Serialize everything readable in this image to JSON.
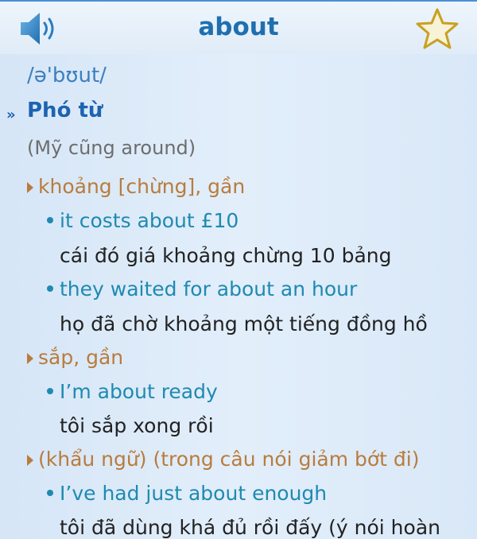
{
  "header": {
    "title": "about",
    "speaker_icon": "speaker-icon",
    "favorite_icon": "star-icon"
  },
  "entry": {
    "pronunciation": "/ə'bʊut/",
    "part_of_speech": "Phó từ",
    "note": "(Mỹ cũng around)",
    "senses": [
      {
        "meaning": "khoảng [chừng], gần",
        "examples": [
          {
            "en": "it costs about £10",
            "vi": "cái đó giá khoảng chừng 10 bảng"
          },
          {
            "en": "they waited for about an hour",
            "vi": "họ đã chờ khoảng một tiếng đồng hồ"
          }
        ]
      },
      {
        "meaning": "sắp, gần",
        "examples": [
          {
            "en": "I’m about ready",
            "vi": "tôi sắp xong rồi"
          }
        ]
      },
      {
        "meaning": "(khẩu ngữ) (trong câu nói giảm bớt đi)",
        "examples": [
          {
            "en": "I’ve had just about enough",
            "vi": "tôi đã dùng khá đủ rồi đấy (ý nói hoàn"
          }
        ]
      }
    ]
  },
  "colors": {
    "title": "#1f6faf",
    "sense": "#b97c3c",
    "example": "#1e8ab1",
    "translation": "#222222"
  }
}
